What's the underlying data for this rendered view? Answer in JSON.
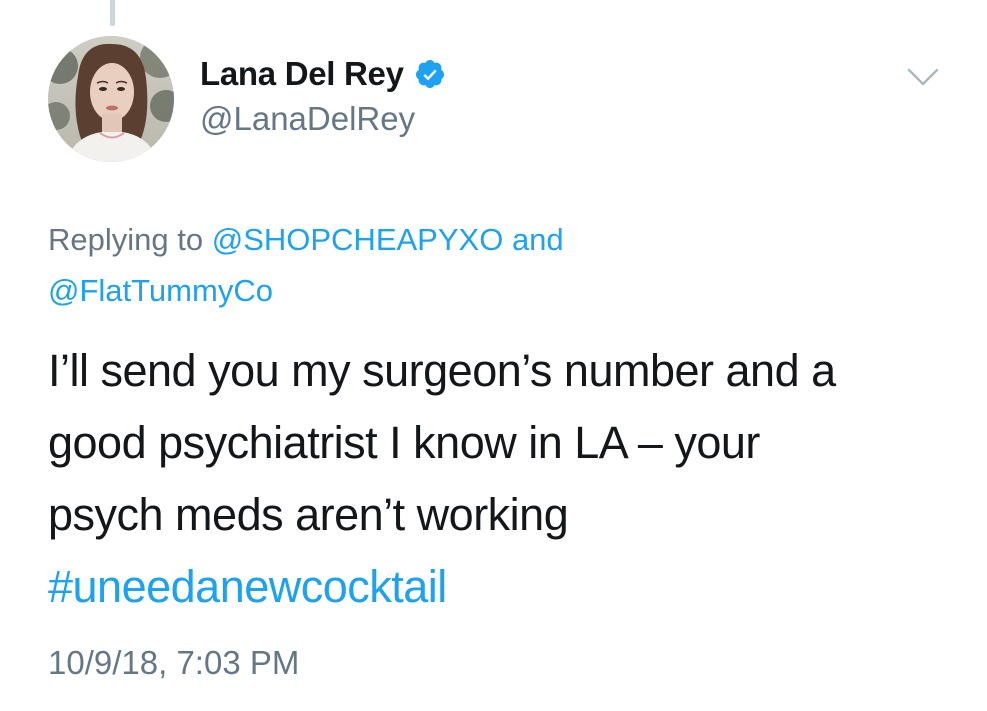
{
  "tweet": {
    "author": {
      "display_name": "Lana Del Rey",
      "handle": "@LanaDelRey",
      "verified": true,
      "avatar_icon": "profile-photo"
    },
    "menu_icon": "chevron-down-icon",
    "reply_context": {
      "prefix": "Replying to",
      "mentions": [
        "@SHOPCHEAPYXO",
        "@FlatTummyCo"
      ],
      "joiner": "and"
    },
    "text_lines": [
      "I’ll send you my surgeon’s number and a",
      "good psychiatrist I know in LA – your",
      "psych meds aren’t working"
    ],
    "hashtag": "#uneedanewcocktail",
    "timestamp": "10/9/18, 7:03 PM"
  },
  "colors": {
    "link": "#1da1f2",
    "secondary_text": "#657786",
    "primary_text": "#14171a",
    "verified_badge": "#1da1f2",
    "thread_line": "#ccd6dd"
  }
}
